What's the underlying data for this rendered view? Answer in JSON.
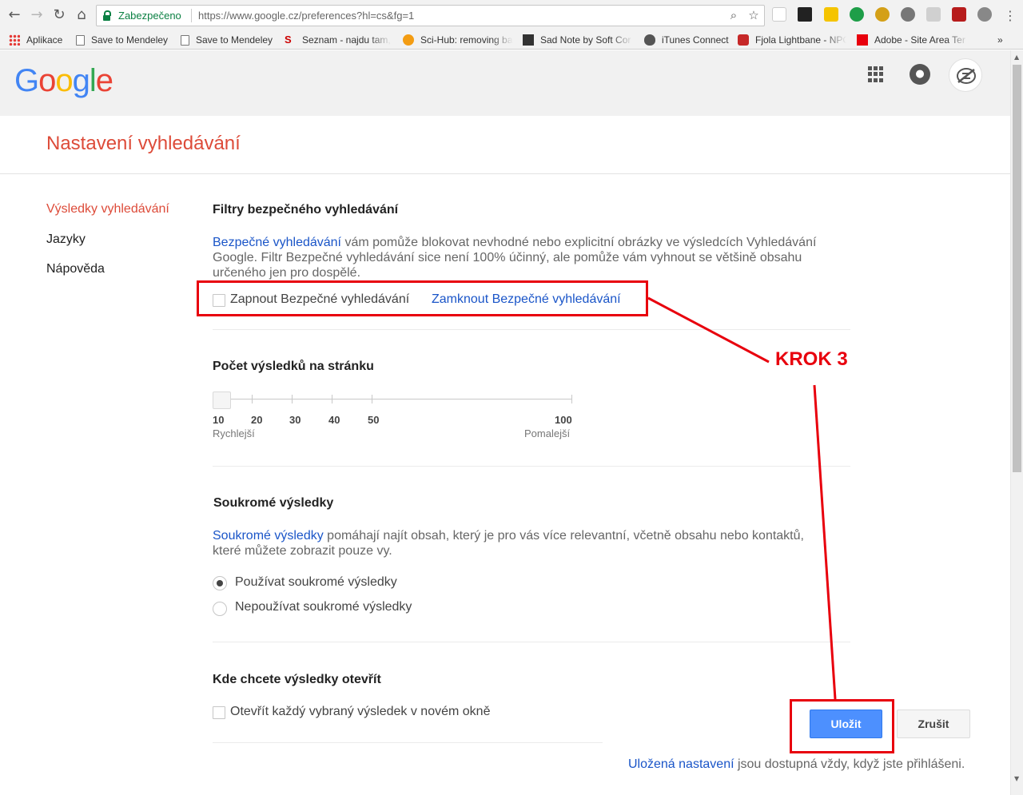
{
  "browser": {
    "secure_label": "Zabezpečeno",
    "url": "https://www.google.cz/preferences?hl=cs&fg=1",
    "bookmarks": [
      {
        "label": "Aplikace",
        "icon": "apps-grid-icon"
      },
      {
        "label": "Save to Mendeley",
        "icon": "page-icon"
      },
      {
        "label": "Save to Mendeley",
        "icon": "page-icon"
      },
      {
        "label": "Seznam - najdu tam,",
        "icon": "seznam-icon"
      },
      {
        "label": "Sci-Hub: removing ba",
        "icon": "scihub-icon"
      },
      {
        "label": "Sad Note by Soft Cor",
        "icon": "soft-corp-icon"
      },
      {
        "label": "iTunes Connect",
        "icon": "apple-icon"
      },
      {
        "label": "Fjola Lightbane - NPC",
        "icon": "dragon-icon"
      },
      {
        "label": "Adobe - Site Area Ter",
        "icon": "adobe-icon"
      }
    ],
    "more_label": "»"
  },
  "header": {
    "logo": [
      "G",
      "o",
      "o",
      "g",
      "l",
      "e"
    ],
    "notif_glyph": "●"
  },
  "page": {
    "title": "Nastavení vyhledávání"
  },
  "sidebar": {
    "items": [
      {
        "label": "Výsledky vyhledávání",
        "active": true
      },
      {
        "label": "Jazyky",
        "active": false
      },
      {
        "label": "Nápověda",
        "active": false
      }
    ]
  },
  "safesearch": {
    "title": "Filtry bezpečného vyhledávání",
    "link": "Bezpečné vyhledávání",
    "text": " vám pomůže blokovat nevhodné nebo explicitní obrázky ve výsledcích Vyhledávání Google. Filtr Bezpečné vyhledávání sice není 100% účinný, ale pomůže vám vyhnout se většině obsahu určeného jen pro dospělé.",
    "checkbox_label": "Zapnout Bezpečné vyhledávání",
    "checked": false,
    "lock_link": "Zamknout Bezpečné vyhledávání"
  },
  "results_per_page": {
    "title": "Počet výsledků na stránku",
    "ticks": [
      "10",
      "20",
      "30",
      "40",
      "50",
      "100"
    ],
    "selected": "10",
    "left_hint": "Rychlejší",
    "right_hint": "Pomalejší"
  },
  "private": {
    "title": "Soukromé výsledky",
    "link": "Soukromé výsledky",
    "text": " pomáhají najít obsah, který je pro vás více relevantní, včetně obsahu nebo kontaktů, které můžete zobrazit pouze vy.",
    "options": [
      {
        "label": "Používat soukromé výsledky",
        "checked": true
      },
      {
        "label": "Nepoužívat soukromé výsledky",
        "checked": false
      }
    ]
  },
  "open_results": {
    "title": "Kde chcete výsledky otevřít",
    "checkbox_label": "Otevřít každý vybraný výsledek v novém okně",
    "checked": false
  },
  "actions": {
    "save": "Uložit",
    "cancel": "Zrušit"
  },
  "footer": {
    "link": "Uložená nastavení",
    "text": " jsou dostupná vždy, když jste přihlášeni."
  },
  "annotation": {
    "label": "KROK 3",
    "color": "#e8000d"
  },
  "colors": {
    "accent_red": "#dd4b39",
    "link_blue": "#1a55c8",
    "primary_button": "#4d90fe"
  }
}
